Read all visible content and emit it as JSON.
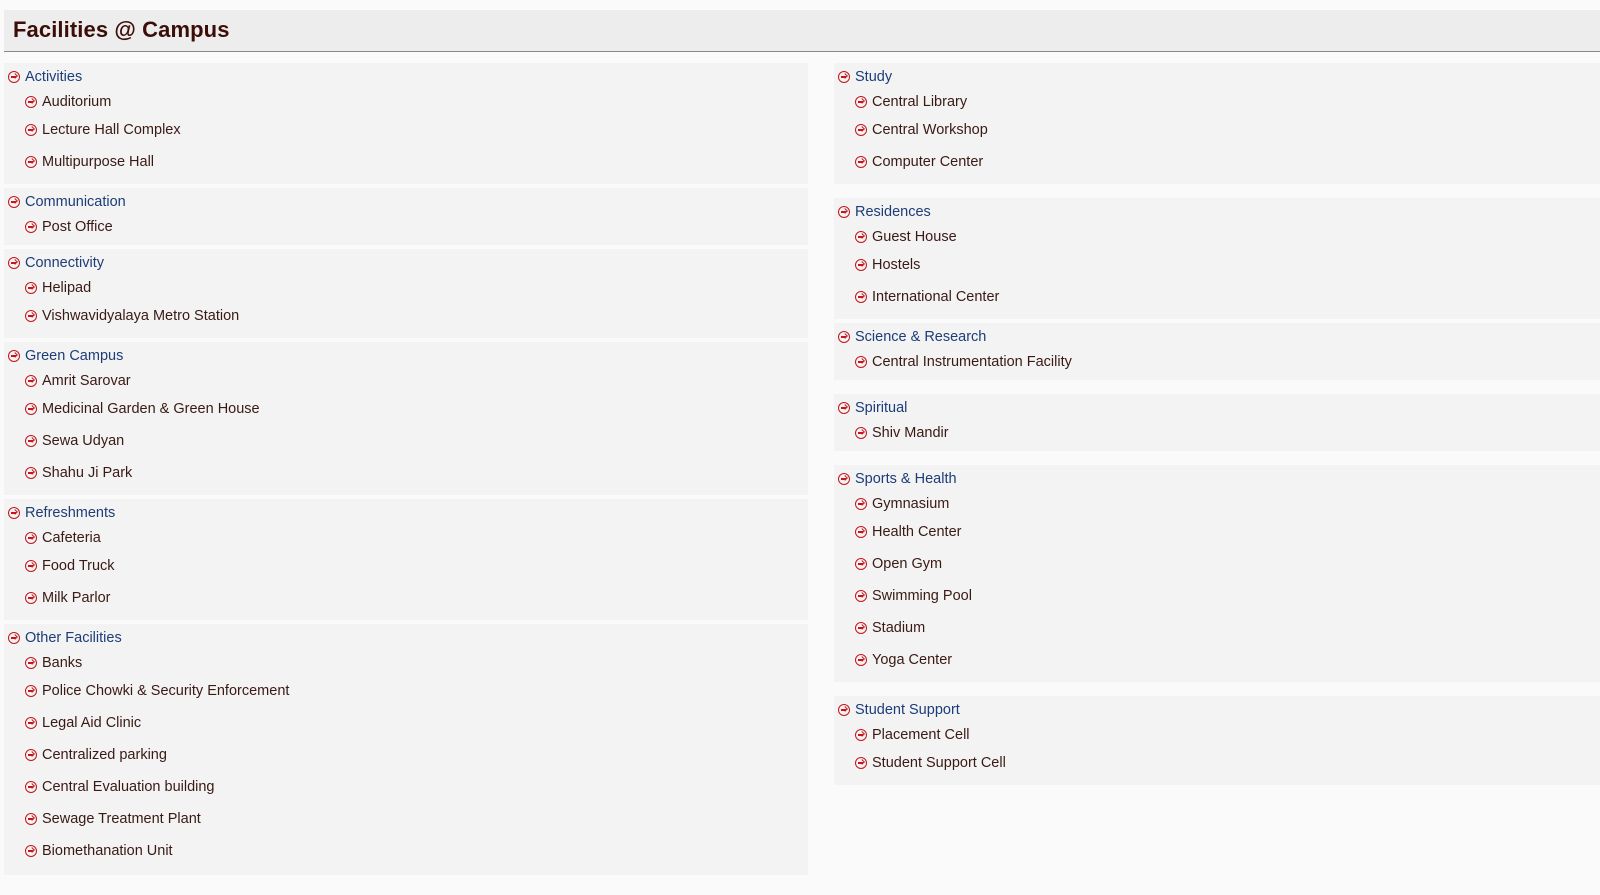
{
  "page": {
    "title": "Facilities @ Campus"
  },
  "left_sections": [
    {
      "category": "Activities",
      "items": [
        "Auditorium",
        "Lecture Hall Complex",
        "Multipurpose Hall"
      ]
    },
    {
      "category": "Communication",
      "items": [
        "Post Office"
      ]
    },
    {
      "category": "Connectivity",
      "items": [
        "Helipad",
        "Vishwavidyalaya Metro Station"
      ]
    },
    {
      "category": "Green Campus",
      "items": [
        "Amrit Sarovar",
        "Medicinal Garden & Green House",
        "Sewa Udyan",
        "Shahu Ji Park"
      ]
    },
    {
      "category": "Refreshments",
      "items": [
        "Cafeteria",
        "Food Truck",
        "Milk Parlor"
      ]
    },
    {
      "category": "Other Facilities",
      "items": [
        "Banks",
        "Police Chowki & Security Enforcement",
        "Legal Aid Clinic",
        "Centralized parking",
        "Central Evaluation building",
        "Sewage Treatment Plant",
        "Biomethanation Unit"
      ]
    }
  ],
  "right_sections": [
    {
      "category": "Study",
      "items": [
        "Central Library",
        "Central Workshop",
        "Computer Center"
      ]
    },
    {
      "category": "Residences",
      "items": [
        "Guest House",
        "Hostels",
        "International Center"
      ]
    },
    {
      "category": "Science & Research",
      "items": [
        "Central Instrumentation Facility"
      ]
    },
    {
      "category": "Spiritual",
      "items": [
        "Shiv Mandir"
      ]
    },
    {
      "category": "Sports & Health",
      "items": [
        "Gymnasium",
        "Health Center",
        "Open Gym",
        "Swimming Pool",
        "Stadium",
        "Yoga Center"
      ]
    },
    {
      "category": "Student Support",
      "items": [
        "Placement Cell",
        "Student Support Cell"
      ]
    }
  ],
  "icons": {
    "bullet": "circle-arrow-right-icon",
    "accent_color": "#c4161c",
    "category_color": "#1c3d78"
  }
}
